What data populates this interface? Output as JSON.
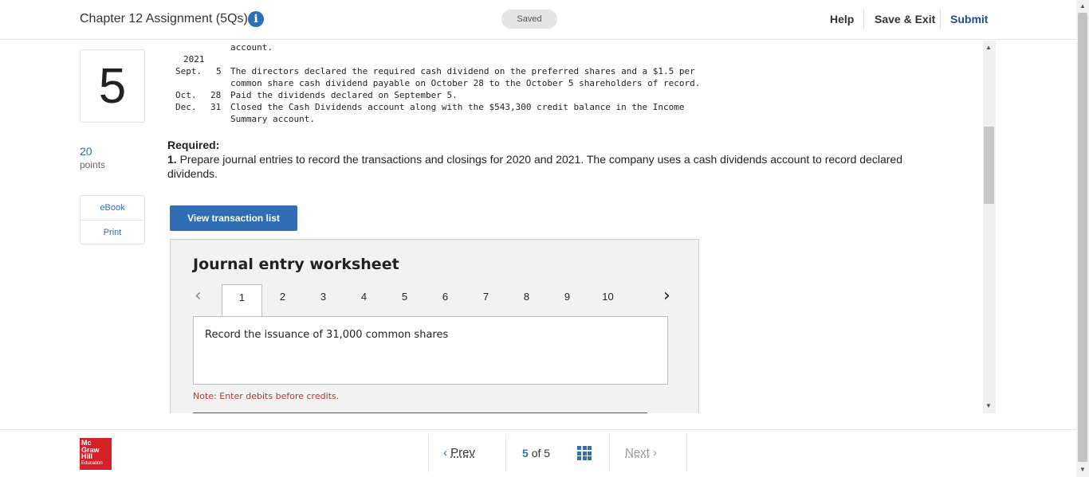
{
  "header": {
    "title": "Chapter 12 Assignment (5Qs)",
    "info_icon": "i",
    "saved_label": "Saved",
    "help": "Help",
    "save_exit": "Save & Exit",
    "submit": "Submit"
  },
  "question": {
    "number": "5",
    "points_value": "20",
    "points_label": "points",
    "ebook": "eBook",
    "print": "Print"
  },
  "problem": {
    "line0": "account.",
    "year": "2021",
    "sept_label": "Sept.",
    "sept_day": "5",
    "sept_text1": "The directors declared the required cash dividend on the preferred shares and a $1.5 per",
    "sept_text2": "common share cash dividend payable on October 28 to the October 5 shareholders of record.",
    "oct_label": "Oct.",
    "oct_day": "28",
    "oct_text": "Paid the dividends declared on September 5.",
    "dec_label": "Dec.",
    "dec_day": "31",
    "dec_text1": "Closed the Cash Dividends account along with the $543,300 credit balance in the Income",
    "dec_text2": "Summary account."
  },
  "required": {
    "heading": "Required:",
    "item_num": "1.",
    "item_text": "Prepare journal entries to record the transactions and closings for 2020 and 2021. The company uses a cash dividends account to record declared dividends."
  },
  "view_transaction_button": "View transaction list",
  "worksheet": {
    "title": "Journal entry worksheet",
    "tabs": [
      "1",
      "2",
      "3",
      "4",
      "5",
      "6",
      "7",
      "8",
      "9",
      "10"
    ],
    "active_tab": "1",
    "description": "Record the issuance of 31,000 common shares",
    "note": "Note: Enter debits before credits."
  },
  "footer": {
    "logo_line1": "Mc",
    "logo_line2": "Graw",
    "logo_line3": "Hill",
    "logo_line4": "Education",
    "prev": "Prev",
    "current": "5",
    "of": "of",
    "total": "5",
    "next": "Next"
  },
  "colors": {
    "accent": "#2f6db5",
    "submit": "#1e4d8c",
    "note": "#b03a2e",
    "logo": "#d42027"
  }
}
